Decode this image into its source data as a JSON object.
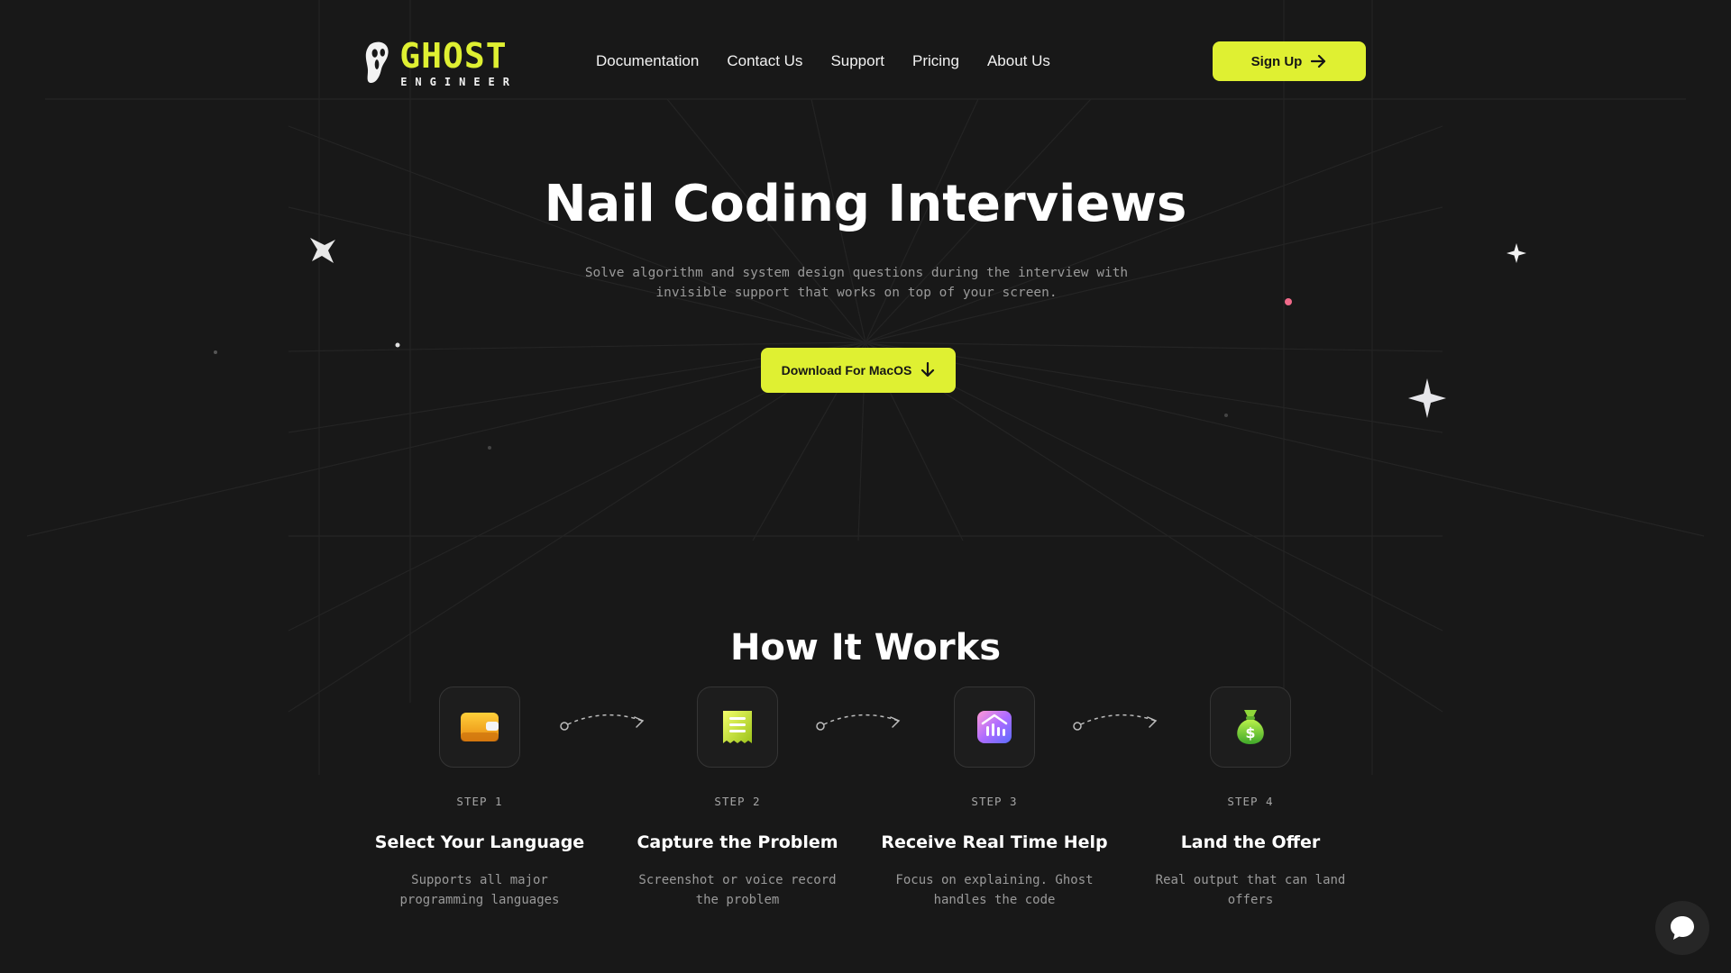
{
  "brand": {
    "name": "GHOST",
    "subtitle": "ENGINEER",
    "accent_color": "#dff032",
    "background_color": "#181818"
  },
  "nav": {
    "items": [
      {
        "label": "Documentation"
      },
      {
        "label": "Contact Us"
      },
      {
        "label": "Support"
      },
      {
        "label": "Pricing"
      },
      {
        "label": "About Us"
      }
    ],
    "signup_label": "Sign Up",
    "signup_icon": "arrow-right-icon"
  },
  "hero": {
    "title": "Nail Coding Interviews",
    "subtitle": "Solve algorithm and system design questions during the interview with invisible support that works on top of your screen.",
    "download_label": "Download For MacOS",
    "download_icon": "arrow-down-icon"
  },
  "how_it_works": {
    "title": "How It Works",
    "steps": [
      {
        "label": "STEP 1",
        "title": "Select Your Language",
        "description": "Supports all major programming languages",
        "icon": "wallet-icon"
      },
      {
        "label": "STEP 2",
        "title": "Capture the Problem",
        "description": "Screenshot or voice record the problem",
        "icon": "receipt-icon"
      },
      {
        "label": "STEP 3",
        "title": "Receive Real Time Help",
        "description": "Focus on explaining. Ghost handles the code",
        "icon": "chart-icon"
      },
      {
        "label": "STEP 4",
        "title": "Land the Offer",
        "description": "Real output that can land offers",
        "icon": "money-bag-icon"
      }
    ]
  },
  "chat": {
    "icon": "chat-bubble-icon"
  }
}
